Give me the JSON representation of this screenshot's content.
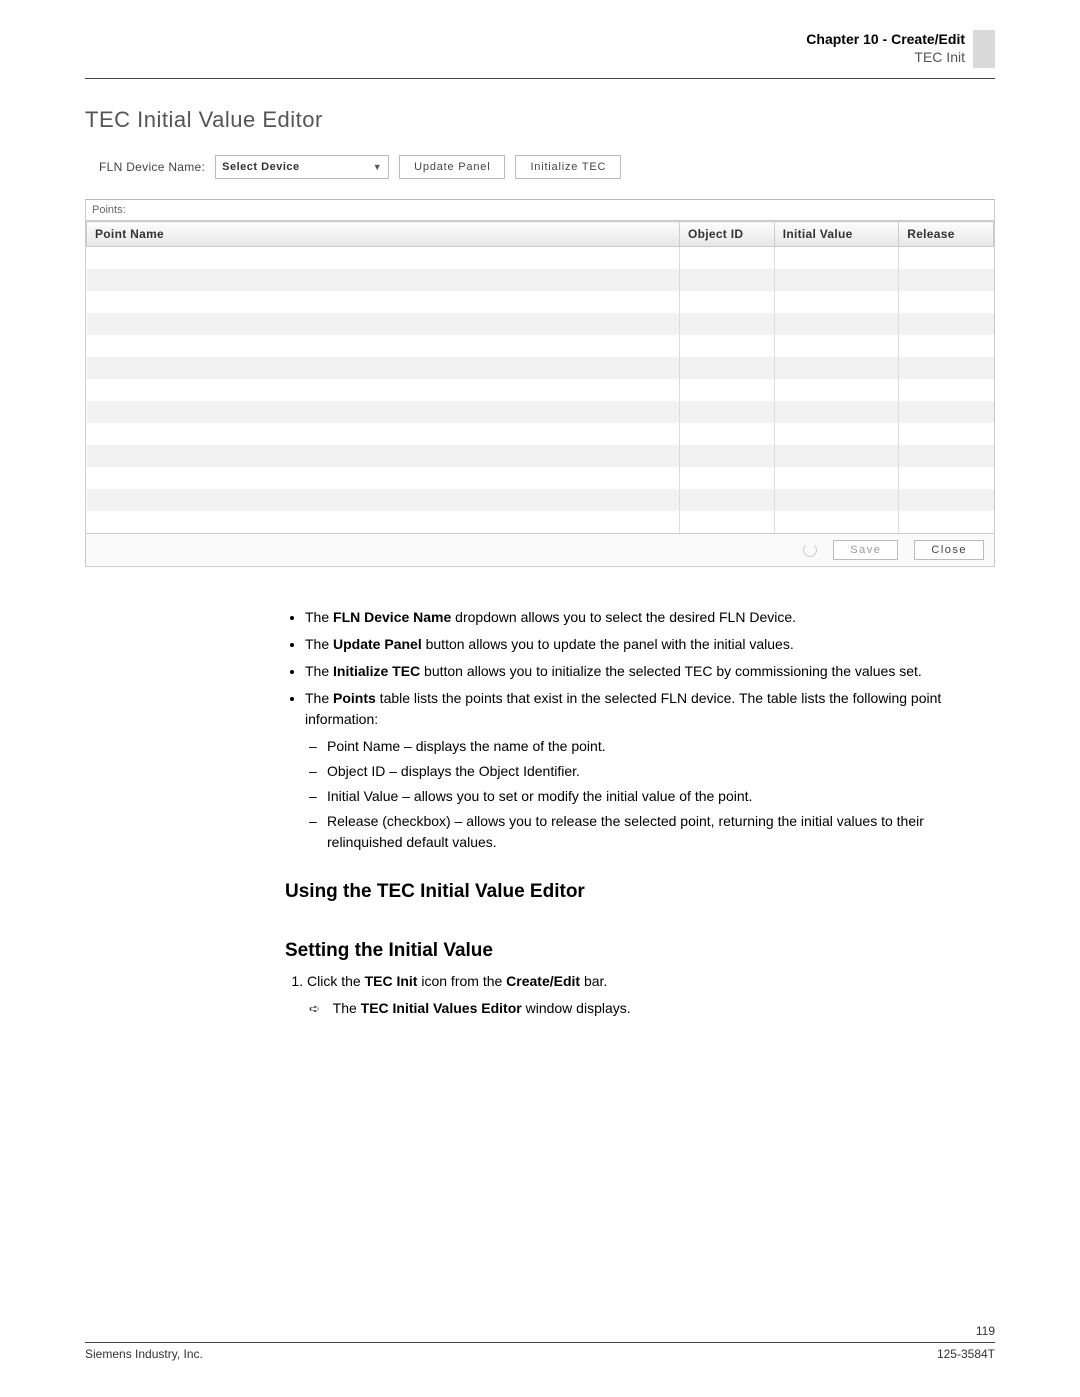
{
  "header": {
    "chapter": "Chapter 10 - Create/Edit",
    "section": "TEC Init"
  },
  "editor": {
    "title": "TEC Initial Value Editor",
    "fln_label": "FLN Device Name:",
    "fln_selected": "Select Device",
    "update_panel_label": "Update Panel",
    "initialize_tec_label": "Initialize TEC",
    "points_caption": "Points:",
    "columns": {
      "point_name": "Point Name",
      "object_id": "Object ID",
      "initial_value": "Initial Value",
      "release": "Release"
    },
    "save_label": "Save",
    "close_label": "Close"
  },
  "bullets": {
    "b1a": "The ",
    "b1b": "FLN Device Name",
    "b1c": " dropdown allows you to select the desired FLN Device.",
    "b2a": "The ",
    "b2b": "Update Panel",
    "b2c": " button allows you to update the panel with the initial values.",
    "b3a": "The ",
    "b3b": "Initialize TEC",
    "b3c": " button allows you to initialize the selected TEC by commissioning the values set.",
    "b4a": "The ",
    "b4b": "Points",
    "b4c": " table lists the points that exist in the selected FLN device. The table lists the following point information:",
    "d1": "Point Name – displays the name of the point.",
    "d2": "Object ID – displays the Object Identifier.",
    "d3": "Initial Value – allows you to set or modify the initial value of the point.",
    "d4": "Release (checkbox) – allows you to release the selected point, returning the initial values to their relinquished default values."
  },
  "h2a": "Using the TEC Initial Value Editor",
  "h2b": "Setting the Initial Value",
  "step1": {
    "pre": "Click the ",
    "b1": "TEC Init",
    "mid": " icon from the ",
    "b2": "Create/Edit",
    "post": " bar."
  },
  "step1res": {
    "pre": "The ",
    "b": "TEC Initial Values Editor",
    "post": " window displays."
  },
  "footer": {
    "page": "119",
    "left": "Siemens Industry, Inc.",
    "right": "125-3584T"
  }
}
